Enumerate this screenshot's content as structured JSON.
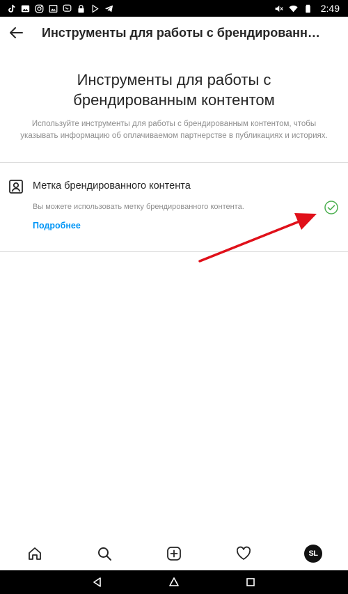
{
  "status_bar": {
    "time": "2:49",
    "left_icons": [
      "tiktok-icon",
      "gallery-icon",
      "instagram-icon",
      "image-icon",
      "chat-icon",
      "lock-icon",
      "play-icon",
      "telegram-icon"
    ],
    "right_icons": [
      "mute-icon",
      "wifi-icon",
      "battery-icon"
    ]
  },
  "header": {
    "title": "Инструменты для работы с брендированным..."
  },
  "hero": {
    "title": "Инструменты для работы с брендированным контентом",
    "description": "Используйте инструменты для работы с брендированным контентом, чтобы указывать информацию об оплачиваемом партнерстве в публикациях и историях."
  },
  "branded_tag": {
    "title": "Метка брендированного контента",
    "description": "Вы можете использовать метку брендированного контента.",
    "link": "Подробнее",
    "status": "enabled"
  },
  "bottom_nav": {
    "items": [
      "home-icon",
      "search-icon",
      "add-post-icon",
      "heart-icon",
      "profile-avatar"
    ],
    "avatar_initials": "SL"
  },
  "colors": {
    "link": "#0095f6",
    "check": "#4caf50",
    "annotation_arrow": "#e0101a"
  }
}
